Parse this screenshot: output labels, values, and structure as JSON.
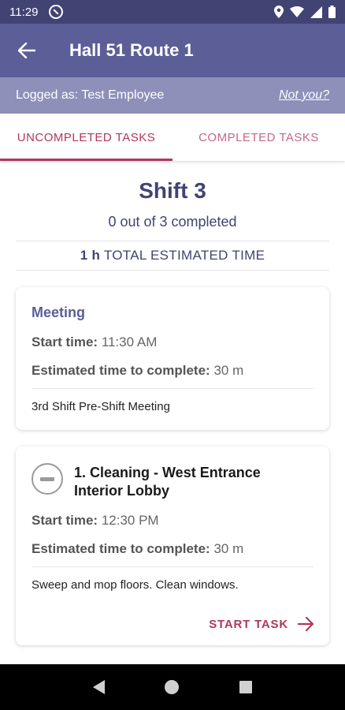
{
  "status_bar": {
    "time": "11:29"
  },
  "app_bar": {
    "title": "Hall 51 Route 1"
  },
  "login": {
    "label": "Logged as: Test Employee",
    "not_you": "Not you?"
  },
  "tabs": [
    {
      "label": "UNCOMPLETED TASKS",
      "active": true
    },
    {
      "label": "COMPLETED TASKS",
      "active": false
    }
  ],
  "summary": {
    "shift": "Shift 3",
    "progress": "0 out of 3 completed",
    "total_time_value": "1 h",
    "total_time_label": "TOTAL ESTIMATED TIME"
  },
  "cards": [
    {
      "type": "Meeting",
      "start_label": "Start time:",
      "start_value": "11:30 AM",
      "estimate_label": "Estimated time to complete:",
      "estimate_value": "30 m",
      "description": "3rd Shift Pre-Shift Meeting"
    },
    {
      "title": "1. Cleaning - West Entrance Interior Lobby",
      "start_label": "Start time:",
      "start_value": "12:30 PM",
      "estimate_label": "Estimated time to complete:",
      "estimate_value": "30 m",
      "description": "Sweep and mop floors.  Clean windows.",
      "action": "START TASK"
    }
  ],
  "colors": {
    "status_bar": "#414373",
    "app_bar": "#5b5e97",
    "login_strip": "#8e90ba",
    "accent": "#b0385a"
  }
}
